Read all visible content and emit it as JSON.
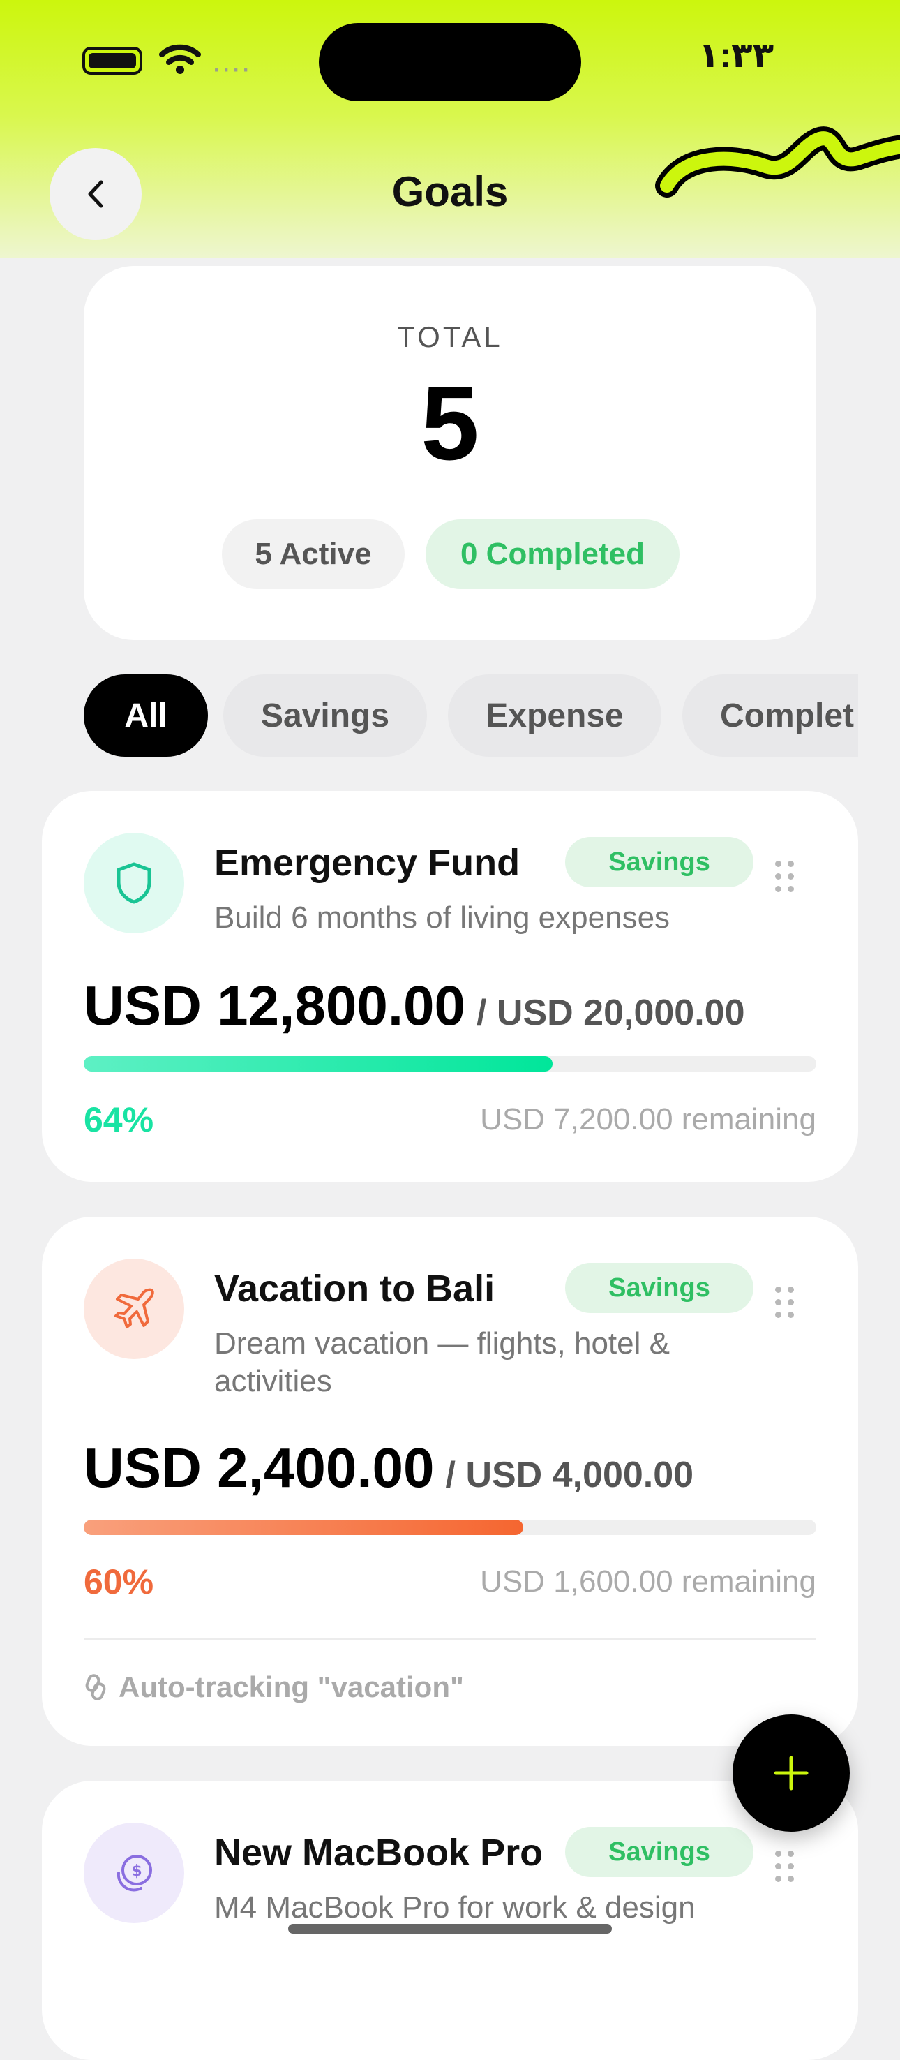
{
  "status_bar": {
    "time": "١:٣٣"
  },
  "header": {
    "title": "Goals",
    "back_icon": "chevron-left-icon"
  },
  "summary": {
    "label": "TOTAL",
    "total": "5",
    "active": "5 Active",
    "completed": "0 Completed"
  },
  "filters": [
    "All",
    "Savings",
    "Expense",
    "Complet"
  ],
  "goals": [
    {
      "icon": "shield-icon",
      "title": "Emergency Fund",
      "tag": "Savings",
      "description": "Build 6 months of living expenses",
      "amount": "USD 12,800.00",
      "target": "/ USD 20,000.00",
      "progress": 0.64,
      "percent": "64%",
      "remaining": "USD 7,200.00 remaining",
      "color": "#19e3a3"
    },
    {
      "icon": "airplane-icon",
      "title": "Vacation to Bali",
      "tag": "Savings",
      "description": "Dream vacation — flights, hotel & activities",
      "amount": "USD 2,400.00",
      "target": "/ USD 4,000.00",
      "progress": 0.6,
      "percent": "60%",
      "remaining": "USD 1,600.00 remaining",
      "tracking": "Auto-tracking \"vacation\"",
      "color": "#f06a3c"
    },
    {
      "icon": "coin-dollar-icon",
      "title": "New MacBook Pro",
      "tag": "Savings",
      "description": "M4 MacBook Pro for work & design",
      "color": "#8a6ee0"
    }
  ],
  "fab": {
    "icon": "plus-icon"
  }
}
